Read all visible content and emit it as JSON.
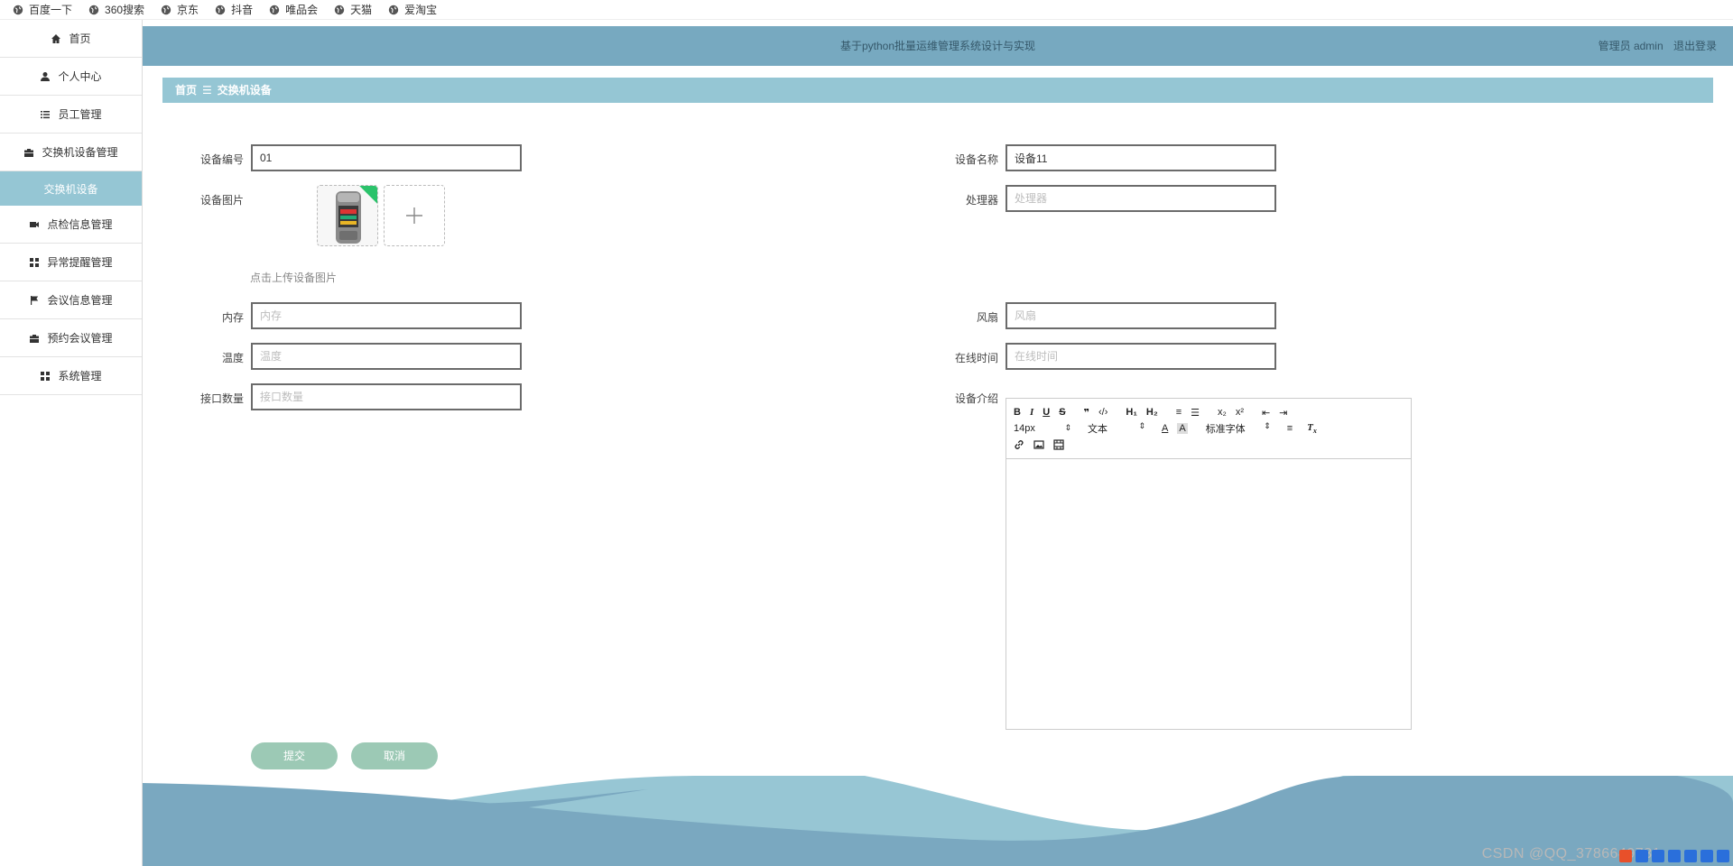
{
  "bookmarks": [
    "百度一下",
    "360搜索",
    "京东",
    "抖音",
    "唯品会",
    "天猫",
    "爱淘宝"
  ],
  "sidebar": {
    "items": [
      {
        "label": "首页",
        "icon": "home-icon"
      },
      {
        "label": "个人中心",
        "icon": "user-icon"
      },
      {
        "label": "员工管理",
        "icon": "list-icon"
      },
      {
        "label": "交换机设备管理",
        "icon": "briefcase-icon"
      },
      {
        "label": "交换机设备",
        "icon": ""
      },
      {
        "label": "点检信息管理",
        "icon": "video-icon"
      },
      {
        "label": "异常提醒管理",
        "icon": "grid-icon"
      },
      {
        "label": "会议信息管理",
        "icon": "flag-icon"
      },
      {
        "label": "预约会议管理",
        "icon": "briefcase-icon"
      },
      {
        "label": "系统管理",
        "icon": "grid-icon"
      }
    ]
  },
  "header": {
    "title": "基于python批量运维管理系统设计与实现",
    "role": "管理员 admin",
    "logout": "退出登录"
  },
  "breadcrumb": {
    "home": "首页",
    "sep": "☰",
    "current": "交换机设备"
  },
  "form": {
    "device_no": {
      "label": "设备编号",
      "value": "01"
    },
    "device_name": {
      "label": "设备名称",
      "value": "设备11"
    },
    "device_image": {
      "label": "设备图片",
      "hint": "点击上传设备图片"
    },
    "processor": {
      "label": "处理器",
      "placeholder": "处理器"
    },
    "memory": {
      "label": "内存",
      "placeholder": "内存"
    },
    "fan": {
      "label": "风扇",
      "placeholder": "风扇"
    },
    "temperature": {
      "label": "温度",
      "placeholder": "温度"
    },
    "online_time": {
      "label": "在线时间",
      "placeholder": "在线时间"
    },
    "port_count": {
      "label": "接口数量",
      "placeholder": "接口数量"
    },
    "intro": {
      "label": "设备介绍"
    }
  },
  "editor": {
    "size": "14px",
    "text_type": "文本",
    "font": "标准字体"
  },
  "buttons": {
    "submit": "提交",
    "cancel": "取消"
  },
  "watermark": "CSDN @QQ_3786649731",
  "colors": {
    "header": "#77a9c0",
    "accent": "#95c6d4",
    "button": "#9cc9b5"
  }
}
